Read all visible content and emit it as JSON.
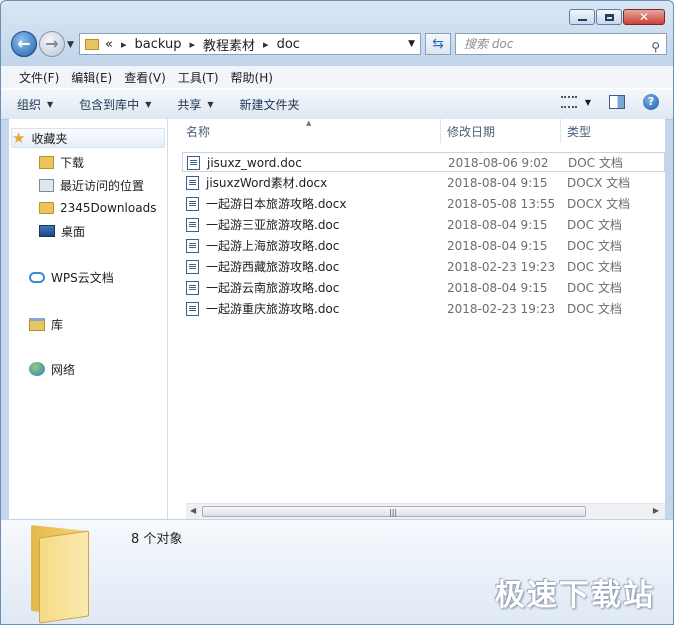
{
  "window": {
    "caption_buttons": {
      "minimize": "minimize",
      "maximize": "maximize",
      "close": "close"
    }
  },
  "address": {
    "overflow": "«",
    "segments": [
      "backup",
      "教程素材",
      "doc"
    ],
    "separator": "▸"
  },
  "search": {
    "placeholder": "搜索 doc"
  },
  "menu": [
    "文件(F)",
    "编辑(E)",
    "查看(V)",
    "工具(T)",
    "帮助(H)"
  ],
  "toolbar": {
    "organize": "组织",
    "include_library": "包含到库中",
    "share": "共享",
    "new_folder": "新建文件夹"
  },
  "nav": {
    "favorites": "收藏夹",
    "downloads": "下载",
    "recent": "最近访问的位置",
    "downloads2345": "2345Downloads",
    "desktop": "桌面",
    "wps_cloud": "WPS云文档",
    "libraries": "库",
    "network": "网络"
  },
  "columns": {
    "name": "名称",
    "date": "修改日期",
    "type": "类型"
  },
  "files": [
    {
      "name": "jisuxz_word.doc",
      "date": "2018-08-06 9:02",
      "type": "DOC 文档"
    },
    {
      "name": "jisuxzWord素材.docx",
      "date": "2018-08-04 9:15",
      "type": "DOCX 文档"
    },
    {
      "name": "一起游日本旅游攻略.docx",
      "date": "2018-05-08 13:55",
      "type": "DOCX 文档"
    },
    {
      "name": "一起游三亚旅游攻略.doc",
      "date": "2018-08-04 9:15",
      "type": "DOC 文档"
    },
    {
      "name": "一起游上海旅游攻略.doc",
      "date": "2018-08-04 9:15",
      "type": "DOC 文档"
    },
    {
      "name": "一起游西藏旅游攻略.doc",
      "date": "2018-02-23 19:23",
      "type": "DOC 文档"
    },
    {
      "name": "一起游云南旅游攻略.doc",
      "date": "2018-08-04 9:15",
      "type": "DOC 文档"
    },
    {
      "name": "一起游重庆旅游攻略.doc",
      "date": "2018-02-23 19:23",
      "type": "DOC 文档"
    }
  ],
  "details": {
    "count": "8 个对象"
  },
  "watermark": "极速下载站"
}
